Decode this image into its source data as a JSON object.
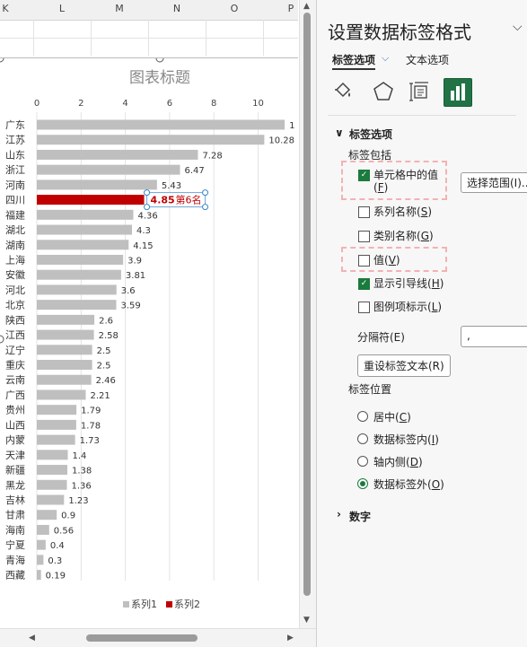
{
  "sheet": {
    "columns": [
      "K",
      "L",
      "M",
      "N",
      "O",
      "P"
    ]
  },
  "chart_data": {
    "type": "bar",
    "title": "图表标题",
    "categories": [
      "广东",
      "江苏",
      "山东",
      "浙江",
      "河南",
      "四川",
      "福建",
      "湖北",
      "湖南",
      "上海",
      "安徽",
      "河北",
      "北京",
      "陕西",
      "江西",
      "辽宁",
      "重庆",
      "云南",
      "广西",
      "贵州",
      "山西",
      "内蒙",
      "天津",
      "新疆",
      "黑龙",
      "吉林",
      "甘肃",
      "海南",
      "宁夏",
      "青海",
      "西藏"
    ],
    "series": [
      {
        "name": "系列1",
        "color": "#bfbfbf",
        "values": [
          11.2,
          10.28,
          7.28,
          6.47,
          5.43,
          null,
          4.36,
          4.3,
          4.15,
          3.9,
          3.81,
          3.6,
          3.59,
          2.6,
          2.58,
          2.5,
          2.5,
          2.46,
          2.21,
          1.79,
          1.78,
          1.73,
          1.4,
          1.38,
          1.36,
          1.23,
          0.9,
          0.56,
          0.4,
          0.3,
          0.19
        ]
      },
      {
        "name": "系列2",
        "color": "#c00000",
        "values": [
          null,
          null,
          null,
          null,
          null,
          4.85,
          null,
          null,
          null,
          null,
          null,
          null,
          null,
          null,
          null,
          null,
          null,
          null,
          null,
          null,
          null,
          null,
          null,
          null,
          null,
          null,
          null,
          null,
          null,
          null,
          null
        ]
      }
    ],
    "data_labels": [
      "1",
      "10.28",
      "7.28",
      "6.47",
      "5.43",
      "4.85",
      "4.36",
      "4.3",
      "4.15",
      "3.9",
      "3.81",
      "3.6",
      "3.59",
      "2.6",
      "2.58",
      "2.5",
      "2.5",
      "2.46",
      "2.21",
      "1.79",
      "1.78",
      "1.73",
      "1.4",
      "1.38",
      "1.36",
      "1.23",
      "0.9",
      "0.56",
      "0.4",
      "0.3",
      "0.19"
    ],
    "highlight_label_extra": "第6名",
    "x_ticks": [
      "0",
      "2",
      "4",
      "6",
      "8",
      "10"
    ],
    "xlim": [
      0,
      12
    ],
    "grid": true,
    "legend": "bottom",
    "legend_entries": [
      "系列1",
      "系列2"
    ]
  },
  "pane": {
    "title": "设置数据标签格式",
    "close_glyph": "⌵",
    "tabs": [
      "标签选项",
      "文本选项"
    ],
    "tab_chevron": "⌵",
    "icons": [
      "fill-bucket-icon",
      "pentagon-effects-icon",
      "size-properties-icon",
      "bar-chart-options-icon"
    ],
    "section_label_options": "标签选项",
    "label_contains": "标签包括",
    "options": [
      {
        "label": "单元格中的值",
        "hotkey": "F",
        "checked": true
      },
      {
        "label": "系列名称",
        "hotkey": "S",
        "checked": false
      },
      {
        "label": "类别名称",
        "hotkey": "G",
        "checked": false
      },
      {
        "label": "值",
        "hotkey": "V",
        "checked": false
      },
      {
        "label": "显示引导线",
        "hotkey": "H",
        "checked": true
      },
      {
        "label": "图例项标示",
        "hotkey": "L",
        "checked": false
      }
    ],
    "select_range_button": "选择范围(I)...",
    "separator_label": "分隔符(E)",
    "separator_value": ",",
    "reset_button": "重设标签文本(R)",
    "label_position": "标签位置",
    "positions": [
      {
        "label": "居中",
        "hotkey": "C",
        "selected": false
      },
      {
        "label": "数据标签内",
        "hotkey": "I",
        "selected": false
      },
      {
        "label": "轴内侧",
        "hotkey": "D",
        "selected": false
      },
      {
        "label": "数据标签外",
        "hotkey": "O",
        "selected": true
      }
    ],
    "section_number": "数字",
    "expanded_glyph": "∨",
    "collapsed_glyph": "›"
  }
}
